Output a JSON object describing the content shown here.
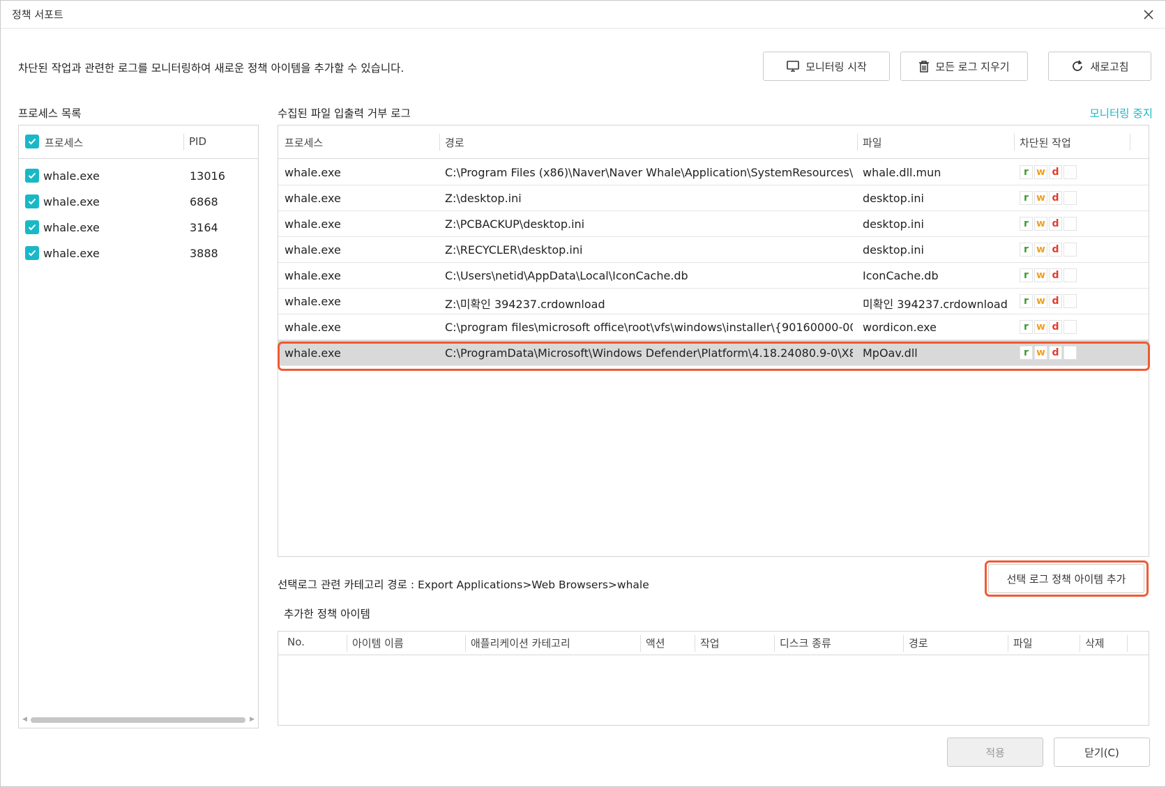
{
  "window": {
    "title": "정책 서포트"
  },
  "description": "차단된 작업과 관련한 로그를 모니터링하여 새로운 정책 아이템을 추가할 수 있습니다.",
  "toolbar": {
    "start_monitoring": "모니터링 시작",
    "clear_logs": "모든 로그 지우기",
    "refresh": "새로고침"
  },
  "process_list": {
    "title": "프로세스 목록",
    "columns": [
      "프로세스",
      "PID"
    ],
    "rows": [
      {
        "name": "whale.exe",
        "pid": "13016"
      },
      {
        "name": "whale.exe",
        "pid": "6868"
      },
      {
        "name": "whale.exe",
        "pid": "3164"
      },
      {
        "name": "whale.exe",
        "pid": "3888"
      }
    ]
  },
  "log": {
    "title": "수집된 파일 입출력 거부 로그",
    "stop_monitoring": "모니터링 중지",
    "columns": [
      "프로세스",
      "경로",
      "파일",
      "차단된 작업"
    ],
    "rows": [
      {
        "process": "whale.exe",
        "path": "C:\\Program Files (x86)\\Naver\\Naver Whale\\Application\\SystemResources\\···",
        "file": "whale.dll.mun",
        "ops": [
          "r",
          "w",
          "d"
        ]
      },
      {
        "process": "whale.exe",
        "path": "Z:\\desktop.ini",
        "file": "desktop.ini",
        "ops": [
          "r",
          "w",
          "d"
        ]
      },
      {
        "process": "whale.exe",
        "path": "Z:\\PCBACKUP\\desktop.ini",
        "file": "desktop.ini",
        "ops": [
          "r",
          "w",
          "d"
        ]
      },
      {
        "process": "whale.exe",
        "path": "Z:\\RECYCLER\\desktop.ini",
        "file": "desktop.ini",
        "ops": [
          "r",
          "w",
          "d"
        ]
      },
      {
        "process": "whale.exe",
        "path": "C:\\Users\\netid\\AppData\\Local\\IconCache.db",
        "file": "IconCache.db",
        "ops": [
          "r",
          "w",
          "d"
        ]
      },
      {
        "process": "whale.exe",
        "path": "Z:\\미확인 394237.crdownload",
        "file": "미확인 394237.crdownload",
        "ops": [
          "r",
          "w",
          "d"
        ]
      },
      {
        "process": "whale.exe",
        "path": "C:\\program files\\microsoft office\\root\\vfs\\windows\\installer\\{90160000-00···",
        "file": "wordicon.exe",
        "ops": [
          "r",
          "w",
          "d"
        ]
      },
      {
        "process": "whale.exe",
        "path": "C:\\ProgramData\\Microsoft\\Windows Defender\\Platform\\4.18.24080.9-0\\X8···",
        "file": "MpOav.dll",
        "ops": [
          "r",
          "w",
          "d"
        ],
        "selected": true
      }
    ]
  },
  "category_path": "선택로그 관련 카테고리 경로 : Export Applications>Web Browsers>whale",
  "add_policy_item": "선택 로그 정책 아이템 추가",
  "added_items": {
    "title": "추가한 정책 아이템",
    "columns": [
      "No.",
      "아이템 이름",
      "애플리케이션 카테고리",
      "액션",
      "작업",
      "디스크 종류",
      "경로",
      "파일",
      "삭제"
    ]
  },
  "footer": {
    "apply": "적용",
    "close": "닫기(C)"
  },
  "colors": {
    "accent": "#19b8c7",
    "highlight": "#f05a32",
    "read": "#3c9a32",
    "write": "#f0a020",
    "delete": "#e23b2c"
  }
}
